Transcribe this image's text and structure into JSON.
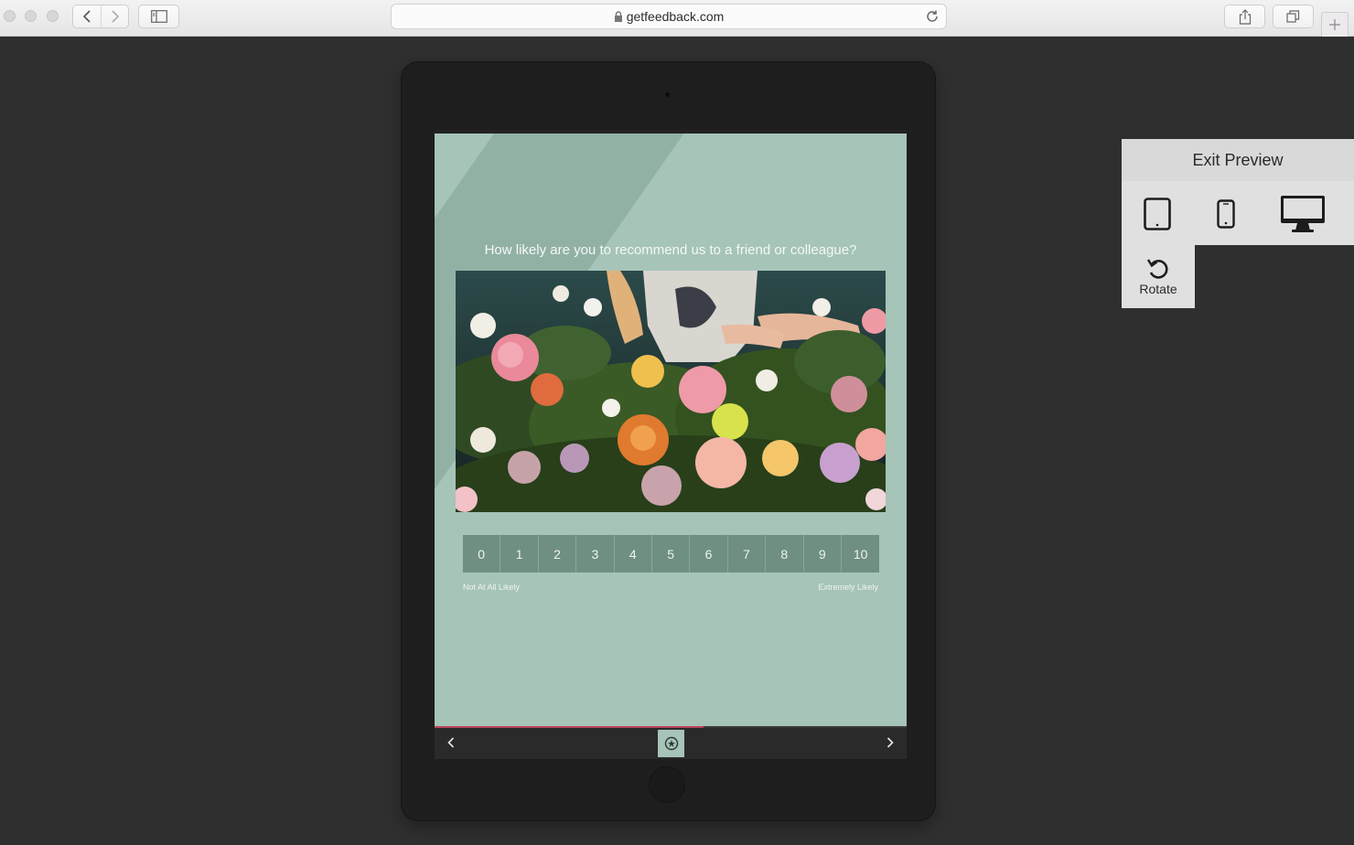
{
  "browser": {
    "url": "getfeedback.com",
    "icons": [
      "back-icon",
      "forward-icon",
      "sidebar-icon",
      "lock-icon",
      "reload-icon",
      "share-icon",
      "tabs-icon",
      "plus-icon"
    ]
  },
  "survey": {
    "question": "How likely are you to recommend us to a friend or colleague?",
    "image_alt": "flowers photo",
    "scale": [
      "0",
      "1",
      "2",
      "3",
      "4",
      "5",
      "6",
      "7",
      "8",
      "9",
      "10"
    ],
    "low_label": "Not At All Likely",
    "high_label": "Extremely Likely",
    "progress": 0.57,
    "colors": {
      "background": "#a6c4b8",
      "stripe": "#92b1a5",
      "scale_button": "#6f8f83",
      "progress": "#b7445a"
    }
  },
  "preview_panel": {
    "exit_label": "Exit Preview",
    "devices": [
      "tablet-icon",
      "phone-icon",
      "desktop-icon"
    ],
    "rotate_label": "Rotate"
  }
}
